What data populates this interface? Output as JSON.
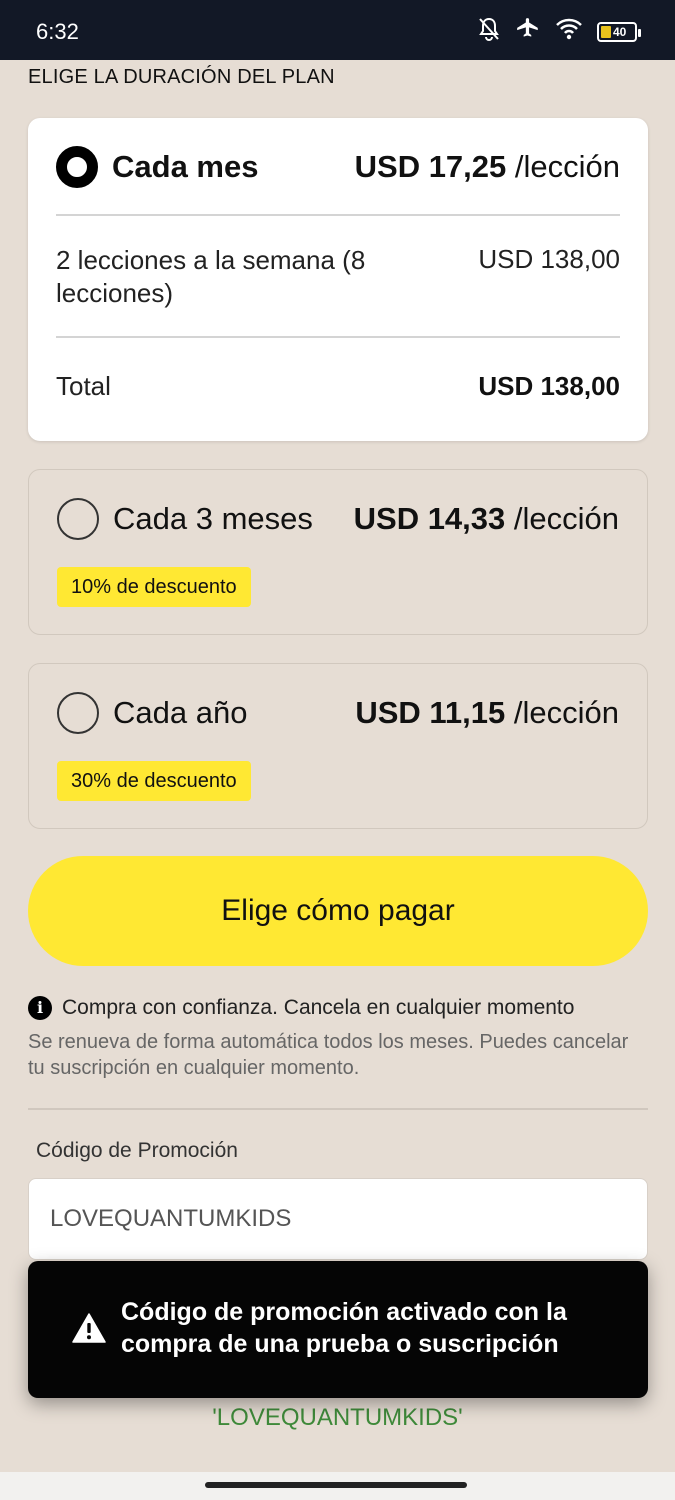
{
  "status_bar": {
    "time": "6:32",
    "battery_level": "40",
    "icons": [
      "bell-off-icon",
      "airplane-icon",
      "wifi-icon",
      "battery-icon"
    ]
  },
  "section_title": "ELIGE LA DURACIÓN DEL PLAN",
  "plans": [
    {
      "name": "Cada mes",
      "price_amount": "USD 17,25",
      "price_unit": " /lección",
      "selected": true,
      "detail_label": "2 lecciones a la semana (8 lecciones)",
      "detail_price": "USD 138,00",
      "total_label": "Total",
      "total_value": "USD 138,00"
    },
    {
      "name": "Cada 3 meses",
      "price_amount": "USD 14,33",
      "price_unit": " /lección",
      "selected": false,
      "discount": "10% de descuento"
    },
    {
      "name": "Cada año",
      "price_amount": "USD 11,15",
      "price_unit": " /lección",
      "selected": false,
      "discount": "30% de descuento"
    }
  ],
  "cta_label": "Elige cómo pagar",
  "info": {
    "headline": "Compra con confianza. Cancela en cualquier momento",
    "renewal": "Se renueva de forma automática todos los meses. Puedes cancelar tu suscripción en cualquier momento."
  },
  "promo": {
    "label": "Código de Promoción",
    "value": "LOVEQUANTUMKIDS",
    "applied_code": "'LOVEQUANTUMKIDS'"
  },
  "toast": {
    "message": "Código de promoción activado con la compra de una prueba o suscripción"
  },
  "colors": {
    "background": "#e6ddd4",
    "accent_yellow": "#ffe833",
    "status_bar": "#121826",
    "toast": "#050505",
    "promo_applied_green": "#3f8a3a"
  }
}
